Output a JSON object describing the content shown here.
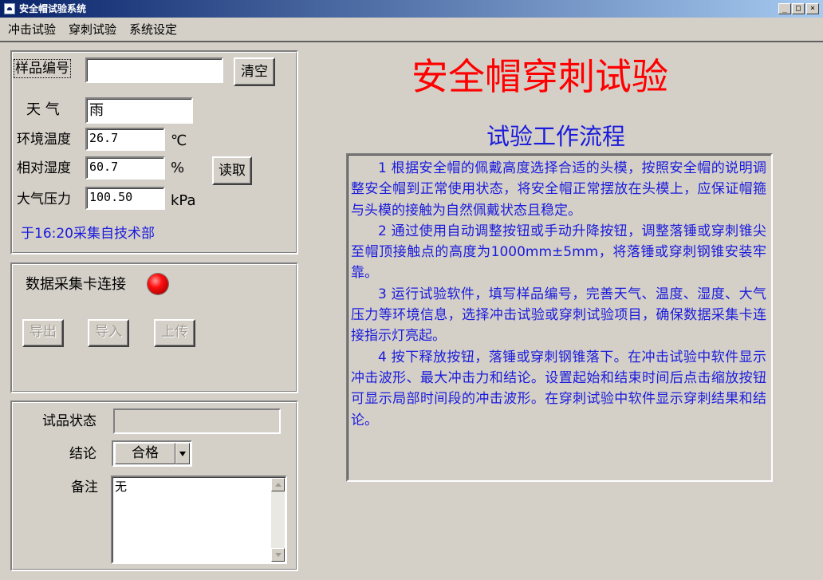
{
  "window": {
    "title": "安全帽试验系统",
    "minimize": "_",
    "maximize": "□",
    "close": "×"
  },
  "menu": {
    "items": [
      "冲击试验",
      "穿刺试验",
      "系统设定"
    ]
  },
  "sample": {
    "id_label": "样品编号",
    "id_value": "",
    "clear_button": "清空",
    "weather_label": "天 气",
    "weather_value": "雨",
    "temp_label": "环境温度",
    "temp_value": "26.7",
    "temp_unit": "℃",
    "humidity_label": "相对湿度",
    "humidity_value": "60.7",
    "humidity_unit": "%",
    "read_button": "读取",
    "pressure_label": "大气压力",
    "pressure_value": "100.50",
    "pressure_unit": "kPa",
    "source_note": "于16:20采集自技术部"
  },
  "daq": {
    "label": "数据采集卡连接",
    "indicator_color": "#ff0000",
    "export_button": "导出",
    "import_button": "导入",
    "upload_button": "上传"
  },
  "result": {
    "status_label": "试品状态",
    "status_value": "",
    "conclusion_label": "结论",
    "conclusion_value": "合格",
    "remarks_label": "备注",
    "remarks_value": "无"
  },
  "main": {
    "title": "安全帽穿刺试验",
    "title_color": "#ff0000",
    "flow_title": "试验工作流程",
    "text_color": "#1a1adc",
    "steps": [
      "1 根据安全帽的佩戴高度选择合适的头模，按照安全帽的说明调整安全帽到正常使用状态，将安全帽正常摆放在头模上，应保证帽箍与头模的接触为自然佩戴状态且稳定。",
      "2 通过使用自动调整按钮或手动升降按钮，调整落锤或穿刺锥尖至帽顶接触点的高度为1000mm±5mm，将落锤或穿刺钢锥安装牢靠。",
      "3 运行试验软件，填写样品编号，完善天气、温度、湿度、大气压力等环境信息，选择冲击试验或穿刺试验项目，确保数据采集卡连接指示灯亮起。",
      "4 按下释放按钮，落锤或穿刺钢锥落下。在冲击试验中软件显示冲击波形、最大冲击力和结论。设置起始和结束时间后点击缩放按钮可显示局部时间段的冲击波形。在穿刺试验中软件显示穿刺结果和结论。"
    ]
  }
}
